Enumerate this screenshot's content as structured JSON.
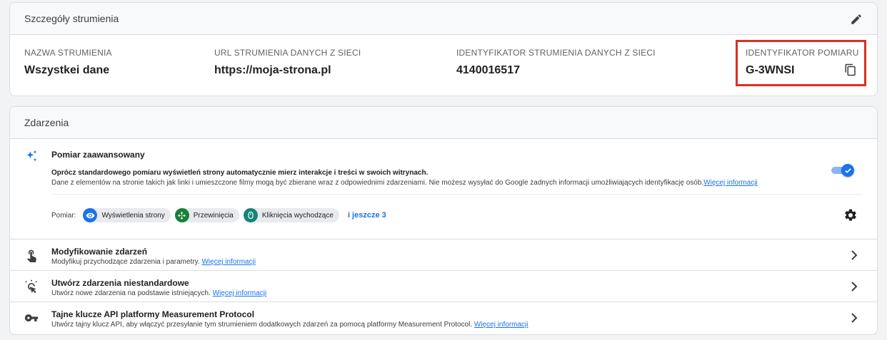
{
  "details": {
    "header": "Szczegóły strumienia",
    "fields": [
      {
        "label": "NAZWA STRUMIENIA",
        "value": "Wszystkei dane"
      },
      {
        "label": "URL STRUMIENIA DANYCH Z SIECI",
        "value": "https://moja-strona.pl"
      },
      {
        "label": "IDENTYFIKATOR STRUMIENIA DANYCH Z SIECI",
        "value": "4140016517"
      },
      {
        "label": "IDENTYFIKATOR POMIARU",
        "value": "G-3WNSI"
      }
    ],
    "highlight_color": "#d93025"
  },
  "events": {
    "header": "Zdarzenia",
    "advanced": {
      "title": "Pomiar zaawansowany",
      "desc1": "Oprócz standardowego pomiaru wyświetleń strony automatycznie mierz interakcje i treści w swoich witrynach.",
      "desc2": "Dane z elementów na stronie takich jak linki i umieszczone filmy mogą być zbierane wraz z odpowiednimi zdarzeniami. Nie możesz wysyłać do Google żadnych informacji umożliwiających identyfikację osób.",
      "link": "Więcej informacji",
      "toggle_on": true,
      "measure_label": "Pomiar:",
      "chips": [
        {
          "label": "Wyświetlenia strony",
          "icon": "eye-icon",
          "color": "#1a73e8"
        },
        {
          "label": "Przewinięcia",
          "icon": "scroll-icon",
          "color": "#188038"
        },
        {
          "label": "Kliknięcia wychodzące",
          "icon": "mouse-icon",
          "color": "#12857a"
        }
      ],
      "more": "i jeszcze 3"
    },
    "rows": [
      {
        "title": "Modyfikowanie zdarzeń",
        "sub": "Modyfikuj przychodzące zdarzenia i parametry.",
        "link": "Więcej informacji",
        "icon": "touch-icon"
      },
      {
        "title": "Utwórz zdarzenia niestandardowe",
        "sub": "Utwórz nowe zdarzenia na podstawie istniejących.",
        "link": "Więcej informacji",
        "icon": "click-sparkle-icon"
      },
      {
        "title": "Tajne klucze API platformy Measurement Protocol",
        "sub": "Utwórz tajny klucz API, aby włączyć przesyłanie tym strumieniem dodatkowych zdarzeń za pomocą platformy Measurement Protocol.",
        "link": "Więcej informacji",
        "icon": "key-icon"
      }
    ]
  }
}
